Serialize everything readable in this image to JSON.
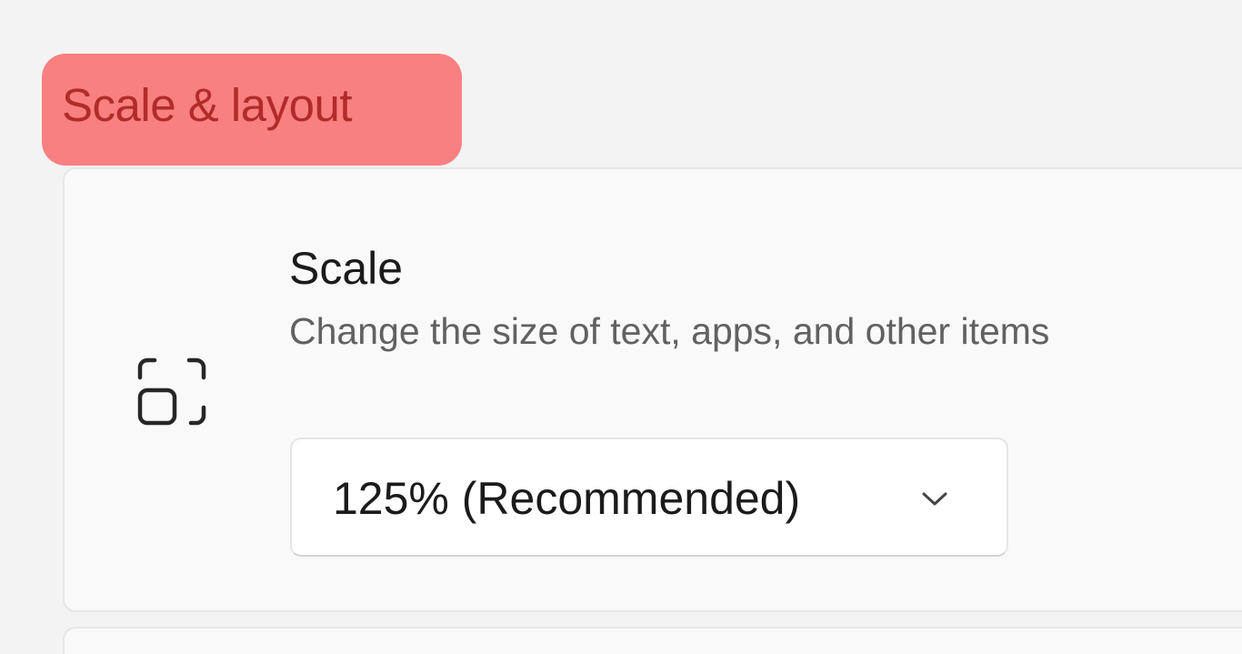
{
  "section": {
    "title": "Scale & layout"
  },
  "scale_setting": {
    "icon": "scale-icon",
    "title": "Scale",
    "description": "Change the size of text, apps, and other items",
    "dropdown": {
      "selected": "125% (Recommended)",
      "icon": "chevron-down-icon"
    }
  },
  "colors": {
    "header_highlight": "#f98080",
    "header_text": "#b22b2b",
    "card_background": "#f9f9f9",
    "page_background": "#f3f3f3"
  }
}
